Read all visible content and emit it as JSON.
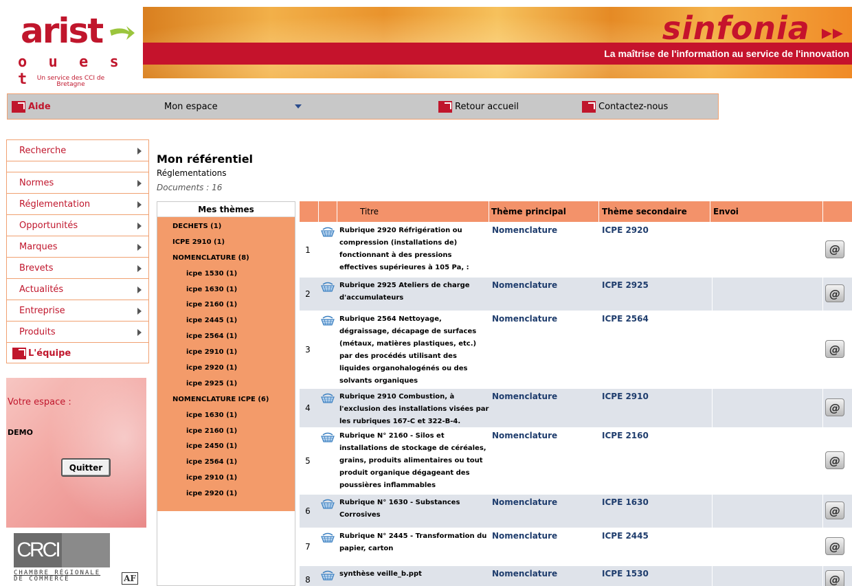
{
  "header": {
    "logo": {
      "word": "arist",
      "sub": "o u e s t",
      "caption": "Un service des CCI de Bretagne"
    },
    "brand": "sinfonia",
    "tagline": "La maîtrise de l'information au service de l'innovation"
  },
  "navbar": {
    "aide": "Aide",
    "espace": "Mon espace",
    "retour": "Retour accueil",
    "contact": "Contactez-nous"
  },
  "menu": {
    "items": [
      "Recherche",
      "Normes",
      "Réglementation",
      "Opportunités",
      "Marques",
      "Brevets",
      "Actualités",
      "Entreprise",
      "Produits"
    ],
    "team": "L'équipe"
  },
  "espace": {
    "title": "Votre espace :",
    "user": "DEMO",
    "quit": "Quitter"
  },
  "crci": {
    "logo": "CRCI",
    "line1": "CHAMBRE RÉGIONALE",
    "line2": "DE COMMERCE",
    "af": "AF"
  },
  "main": {
    "title": "Mon référentiel",
    "subtitle": "Réglementations",
    "docs": "Documents : 16"
  },
  "themes": {
    "header": "Mes thèmes",
    "items": [
      {
        "label": "DECHETS (1)",
        "sub": false
      },
      {
        "label": "ICPE 2910 (1)",
        "sub": false
      },
      {
        "label": "NOMENCLATURE (8)",
        "sub": false
      },
      {
        "label": "icpe 1530 (1)",
        "sub": true
      },
      {
        "label": "icpe 1630 (1)",
        "sub": true
      },
      {
        "label": "icpe 2160 (1)",
        "sub": true
      },
      {
        "label": "icpe 2445 (1)",
        "sub": true
      },
      {
        "label": "icpe 2564 (1)",
        "sub": true
      },
      {
        "label": "icpe 2910 (1)",
        "sub": true
      },
      {
        "label": "icpe 2920 (1)",
        "sub": true
      },
      {
        "label": "icpe 2925 (1)",
        "sub": true
      },
      {
        "label": "NOMENCLATURE ICPE (6)",
        "sub": false
      },
      {
        "label": "icpe 1630 (1)",
        "sub": true
      },
      {
        "label": "icpe 2160 (1)",
        "sub": true
      },
      {
        "label": "icpe 2450 (1)",
        "sub": true
      },
      {
        "label": "icpe 2564 (1)",
        "sub": true
      },
      {
        "label": "icpe 2910 (1)",
        "sub": true
      },
      {
        "label": "icpe 2920 (1)",
        "sub": true
      }
    ]
  },
  "table": {
    "columns": {
      "titre": "Titre",
      "theme_principal": "Thème principal",
      "theme_secondaire": "Thème secondaire",
      "envoi": "Envoi"
    },
    "rows": [
      {
        "n": "1",
        "titre": "Rubrique 2920 Réfrigération ou compression (installations de) fonctionnant à des pressions effectives supérieures à 105 Pa, :",
        "tp": "Nomenclature",
        "ts": "ICPE 2920",
        "mail": "@"
      },
      {
        "n": "2",
        "titre": "Rubrique 2925 Ateliers de charge d'accumulateurs",
        "tp": "Nomenclature",
        "ts": "ICPE 2925",
        "mail": "@"
      },
      {
        "n": "3",
        "titre": "Rubrique 2564 Nettoyage, dégraissage, décapage de surfaces (métaux, matières plastiques, etc.) par des procédés utilisant des liquides organohalogénés ou des solvants organiques",
        "tp": "Nomenclature",
        "ts": "ICPE 2564",
        "mail": "@"
      },
      {
        "n": "4",
        "titre": "Rubrique 2910 Combustion, à l'exclusion des installations visées par les rubriques 167-C et 322-B-4.",
        "tp": "Nomenclature",
        "ts": "ICPE 2910",
        "mail": "@"
      },
      {
        "n": "5",
        "titre": "Rubrique N° 2160 - Silos et installations de stockage de céréales, grains, produits alimentaires ou tout produit organique dégageant des poussières inflammables",
        "tp": "Nomenclature",
        "ts": "ICPE 2160",
        "mail": "@"
      },
      {
        "n": "6",
        "titre": "Rubrique N° 1630 - Substances Corrosives",
        "tp": "Nomenclature",
        "ts": "ICPE 1630",
        "mail": "@"
      },
      {
        "n": "7",
        "titre": "Rubrique N° 2445 - Transformation du papier, carton",
        "tp": "Nomenclature",
        "ts": "ICPE 2445",
        "mail": "@"
      },
      {
        "n": "8",
        "titre": "synthèse veille_b.ppt",
        "tp": "Nomenclature",
        "ts": "ICPE 1530",
        "mail": "@"
      }
    ]
  },
  "colors": {
    "brand_red": "#c0162c",
    "orange": "#f39b6a",
    "row_alt": "#dfe3ea",
    "link_blue": "#1f3d6d"
  }
}
